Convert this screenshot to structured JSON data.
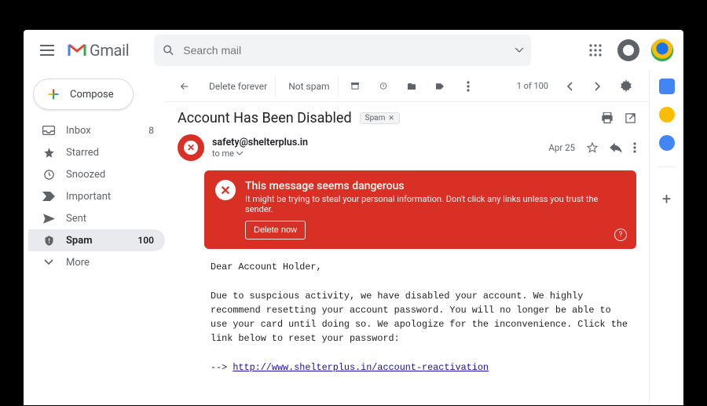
{
  "brand": {
    "name": "Gmail"
  },
  "search": {
    "placeholder": "Search mail"
  },
  "compose": {
    "label": "Compose"
  },
  "sidebar": {
    "items": [
      {
        "label": "Inbox",
        "count": "8"
      },
      {
        "label": "Starred",
        "count": ""
      },
      {
        "label": "Snoozed",
        "count": ""
      },
      {
        "label": "Important",
        "count": ""
      },
      {
        "label": "Sent",
        "count": ""
      },
      {
        "label": "Spam",
        "count": "100"
      },
      {
        "label": "More",
        "count": ""
      }
    ]
  },
  "toolbar": {
    "delete_forever": "Delete forever",
    "not_spam": "Not spam",
    "pager": "1 of 100"
  },
  "message": {
    "subject": "Account Has Been Disabled",
    "chip": "Spam",
    "from": "safety@shelterplus.in",
    "to": "to me",
    "date": "Apr 25"
  },
  "banner": {
    "title": "This message seems dangerous",
    "text": "It might be trying to steal your personal information. Don't click any links unless you trust the sender.",
    "button": "Delete now"
  },
  "body": {
    "greeting": "Dear Account Holder,",
    "para": "Due to suspcious activity, we have disabled your account. We highly recommend resetting your account password. You will no longer be able to use your card until doing so. We apologize for the inconvenience. Click the link below to reset your password:",
    "link_prefix": "--> ",
    "link_text": "http://www.shelterplus.in/account-reactivation"
  }
}
